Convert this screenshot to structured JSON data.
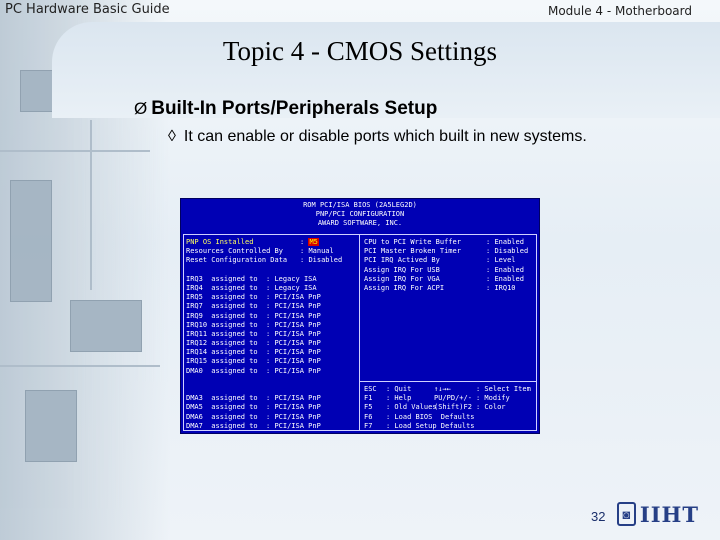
{
  "header": {
    "left": "PC Hardware Basic Guide",
    "right": "Module 4 - Motherboard"
  },
  "title": "Topic 4 - CMOS Settings",
  "bullets": {
    "level1": {
      "marker": "Ø",
      "text": "Built-In Ports/Peripherals Setup"
    },
    "level2": {
      "marker": "◊",
      "text": "It can enable or disable ports which built in new systems."
    }
  },
  "bios": {
    "header_lines": [
      "ROM PCI/ISA BIOS (2A5LEG2D)",
      "PNP/PCI CONFIGURATION",
      "AWARD SOFTWARE, INC."
    ],
    "left_top": [
      {
        "label": "PNP OS Installed",
        "value": "M5"
      },
      {
        "label": "Resources Controlled By",
        "value": "Manual"
      },
      {
        "label": "Reset Configuration Data",
        "value": "Disabled"
      }
    ],
    "irq_rows": [
      {
        "label": "IRQ3  assigned to",
        "value": "Legacy ISA"
      },
      {
        "label": "IRQ4  assigned to",
        "value": "Legacy ISA"
      },
      {
        "label": "IRQ5  assigned to",
        "value": "PCI/ISA PnP"
      },
      {
        "label": "IRQ7  assigned to",
        "value": "PCI/ISA PnP"
      },
      {
        "label": "IRQ9  assigned to",
        "value": "PCI/ISA PnP"
      },
      {
        "label": "IRQ10 assigned to",
        "value": "PCI/ISA PnP"
      },
      {
        "label": "IRQ11 assigned to",
        "value": "PCI/ISA PnP"
      },
      {
        "label": "IRQ12 assigned to",
        "value": "PCI/ISA PnP"
      },
      {
        "label": "IRQ14 assigned to",
        "value": "PCI/ISA PnP"
      },
      {
        "label": "IRQ15 assigned to",
        "value": "PCI/ISA PnP"
      },
      {
        "label": "DMA0  assigned to",
        "value": "PCI/ISA PnP"
      }
    ],
    "dma_rows": [
      {
        "label": "DMA3  assigned to",
        "value": "PCI/ISA PnP"
      },
      {
        "label": "DMA5  assigned to",
        "value": "PCI/ISA PnP"
      },
      {
        "label": "DMA6  assigned to",
        "value": "PCI/ISA PnP"
      },
      {
        "label": "DMA7  assigned to",
        "value": "PCI/ISA PnP"
      }
    ],
    "right_top": [
      {
        "label": "CPU to PCI Write Buffer",
        "value": "Enabled"
      },
      {
        "label": "PCI Master Broken Timer",
        "value": "Disabled"
      },
      {
        "label": "PCI IRQ Actived By",
        "value": "Level"
      },
      {
        "label": "Assign IRQ For USB",
        "value": "Enabled"
      },
      {
        "label": "Assign IRQ For VGA",
        "value": "Enabled"
      },
      {
        "label": "Assign IRQ For ACPI",
        "value": "IRQ10"
      }
    ],
    "help": [
      {
        "key": "ESC",
        "text": "Quit",
        "key2": "↑↓→←",
        "text2": "Select Item"
      },
      {
        "key": "F1",
        "text": "Help",
        "key2": "PU/PD/+/-",
        "text2": "Modify"
      },
      {
        "key": "F5",
        "text": "Old Values",
        "key2": "(Shift)F2",
        "text2": "Color"
      },
      {
        "key": "F6",
        "text": "Load BIOS  Defaults",
        "key2": "",
        "text2": ""
      },
      {
        "key": "F7",
        "text": "Load Setup Defaults",
        "key2": "",
        "text2": ""
      }
    ]
  },
  "footer": {
    "page_number": "32",
    "logo_text": "IIHT"
  },
  "colors": {
    "bios_bg": "#0000b4",
    "bios_highlight": "#d40000",
    "logo": "#263f86"
  }
}
